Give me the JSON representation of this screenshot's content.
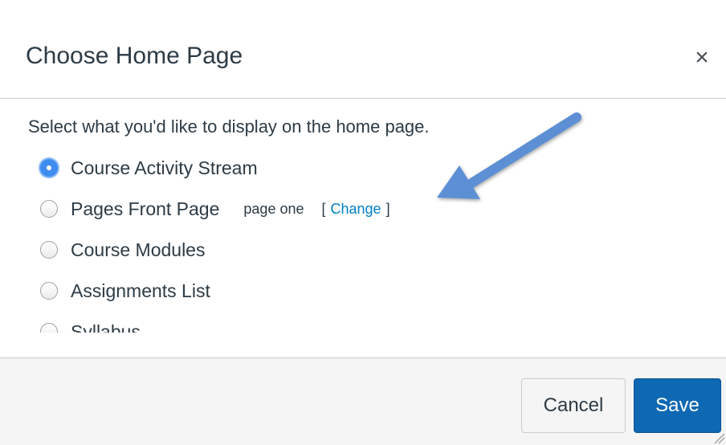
{
  "dialog": {
    "title": "Choose Home Page",
    "close_symbol": "×",
    "instructions": "Select what you'd like to display on the home page.",
    "options": [
      {
        "label": "Course Activity Stream",
        "selected": true
      },
      {
        "label": "Pages Front Page",
        "selected": false,
        "page_name": "page one",
        "change_open": "[",
        "change_label": "Change",
        "change_close": "]"
      },
      {
        "label": "Course Modules",
        "selected": false
      },
      {
        "label": "Assignments List",
        "selected": false
      },
      {
        "label": "Syllabus",
        "selected": false
      }
    ],
    "buttons": {
      "cancel_label": "Cancel",
      "save_label": "Save"
    }
  },
  "colors": {
    "save_button": "#0e68b3",
    "link": "#0081c6",
    "annotation_arrow": "#5b8fd4",
    "radio_selected": "#3f8cf0"
  },
  "icons": {
    "close": "close-icon",
    "annotation": "arrow-annotation-icon",
    "resize": "resize-handle-icon"
  }
}
